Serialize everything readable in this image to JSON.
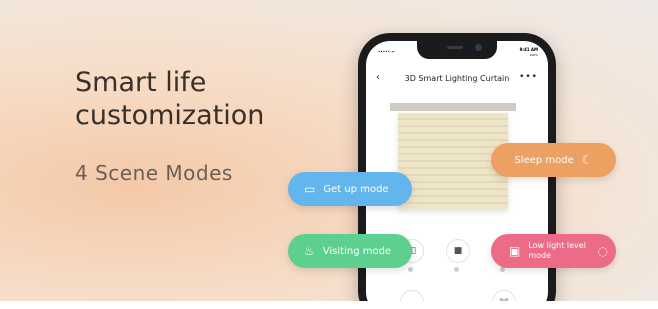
{
  "headline": "Smart life\ncustomization",
  "subline": "4 Scene Modes",
  "phone": {
    "status_time": "9:41 AM",
    "status_signal": "••••• ᯤ",
    "status_battery": "100%",
    "app_title": "3D Smart Lighting Curtain",
    "back_icon": "back-chevron-icon",
    "more_icon": "more-dots-icon"
  },
  "scene_modes": [
    {
      "label": "Get up mode",
      "color": "#63b5ee",
      "icon": "bed-icon"
    },
    {
      "label": "Sleep mode",
      "color": "#eca062",
      "icon": "moon-icon"
    },
    {
      "label": "Visiting mode",
      "color": "#5dcf8f",
      "icon": "guest-icon"
    },
    {
      "label": "Low light level mode",
      "color": "#ec6c88",
      "icon": "dim-light-icon"
    }
  ]
}
